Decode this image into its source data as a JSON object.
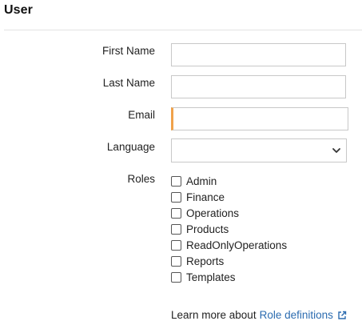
{
  "header": {
    "title": "User"
  },
  "form": {
    "first_name_label": "First Name",
    "first_name_value": "",
    "last_name_label": "Last Name",
    "last_name_value": "",
    "email_label": "Email",
    "email_value": "",
    "language_label": "Language",
    "language_value": "",
    "roles_label": "Roles",
    "roles": [
      {
        "label": "Admin",
        "checked": false
      },
      {
        "label": "Finance",
        "checked": false
      },
      {
        "label": "Operations",
        "checked": false
      },
      {
        "label": "Products",
        "checked": false
      },
      {
        "label": "ReadOnlyOperations",
        "checked": false
      },
      {
        "label": "Reports",
        "checked": false
      },
      {
        "label": "Templates",
        "checked": false
      }
    ]
  },
  "footer": {
    "learn_more_text": "Learn more about",
    "role_definitions_link": "Role definitions"
  },
  "icons": {
    "language_dropdown": "chevron-down-icon",
    "role_definitions": "external-link-icon"
  },
  "colors": {
    "focus_accent": "#f0a24a",
    "link": "#2c6cb0",
    "input_border": "#c8c8c8"
  }
}
